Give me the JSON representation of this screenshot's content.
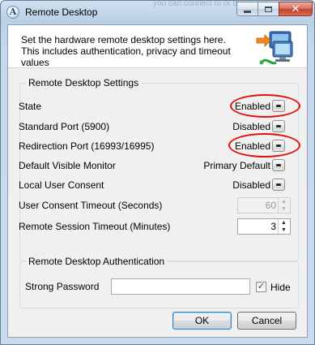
{
  "window": {
    "title": "Remote Desktop",
    "ghost_background_text": "you can connect to or the remot"
  },
  "header": {
    "description": "Set the hardware remote desktop settings here. This includes authentication, privacy and timeout values",
    "graphic_icon": "remote-desktop-computers-icon"
  },
  "settings": {
    "group_title": "Remote Desktop Settings",
    "rows": [
      {
        "label": "State",
        "value": "Enabled",
        "highlighted": true
      },
      {
        "label": "Standard Port (5900)",
        "value": "Disabled",
        "highlighted": false
      },
      {
        "label": "Redirection Port (16993/16995)",
        "value": "Enabled",
        "highlighted": true
      },
      {
        "label": "Default Visible Monitor",
        "value": "Primary Default",
        "highlighted": false
      },
      {
        "label": "Local User Consent",
        "value": "Disabled",
        "highlighted": false
      }
    ],
    "consent_timeout": {
      "label": "User Consent Timeout (Seconds)",
      "value": "60",
      "enabled": false
    },
    "session_timeout": {
      "label": "Remote Session Timeout (Minutes)",
      "value": "3",
      "enabled": true
    }
  },
  "authentication": {
    "group_title": "Remote Desktop Authentication",
    "password_label": "Strong Password",
    "password_value": "",
    "hide_label": "Hide",
    "hide_checked": true
  },
  "buttons": {
    "ok": "OK",
    "cancel": "Cancel"
  },
  "colors": {
    "highlight": "#e01010",
    "title_gradient_top": "#cfe0f0",
    "client_bg": "#f0f0f0"
  }
}
